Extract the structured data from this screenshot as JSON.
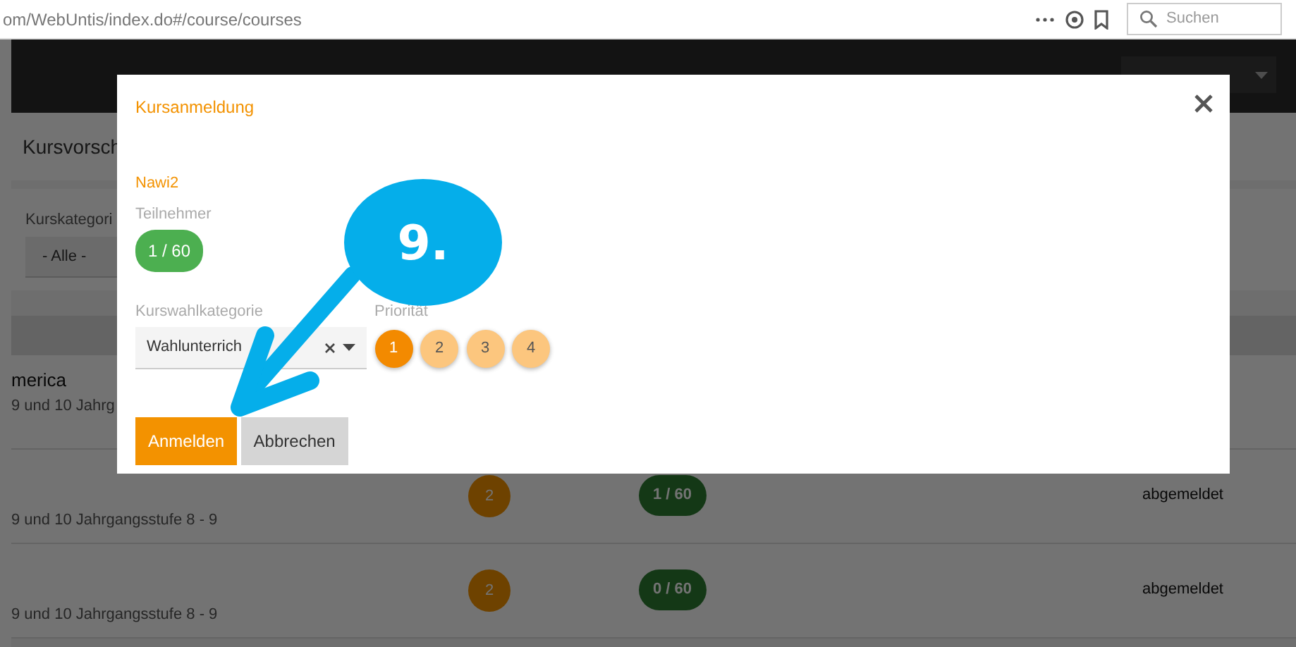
{
  "browser": {
    "url": "om/WebUntis/index.do#/course/courses",
    "search_placeholder": "Suchen"
  },
  "page": {
    "title": "Kursvorsch",
    "filter": {
      "label": "Kurskategori",
      "value": "- Alle -"
    },
    "rows": [
      {
        "title": "merica",
        "subtitle": "9 und 10 Jahrg"
      },
      {
        "priority": "2",
        "participants": "1 / 60",
        "status": "abgemeldet",
        "subtitle": "9 und 10 Jahrgangsstufe 8 - 9"
      },
      {
        "priority": "2",
        "participants": "0 / 60",
        "status": "abgemeldet",
        "subtitle": "9 und 10 Jahrgangsstufe 8 - 9"
      }
    ]
  },
  "modal": {
    "title": "Kursanmeldung",
    "course": "Nawi2",
    "participants_label": "Teilnehmer",
    "participants": "1 / 60",
    "category_label": "Kurswahlkategorie",
    "category_value": "Wahlunterrich",
    "priority_label": "Priorität",
    "priorities": [
      {
        "label": "1",
        "selected": true
      },
      {
        "label": "2",
        "selected": false
      },
      {
        "label": "3",
        "selected": false
      },
      {
        "label": "4",
        "selected": false
      }
    ],
    "buttons": [
      {
        "label": "Anmelden",
        "kind": "primary"
      },
      {
        "label": "Abbrechen",
        "kind": "secondary"
      }
    ]
  },
  "annotation": {
    "label": "9."
  }
}
